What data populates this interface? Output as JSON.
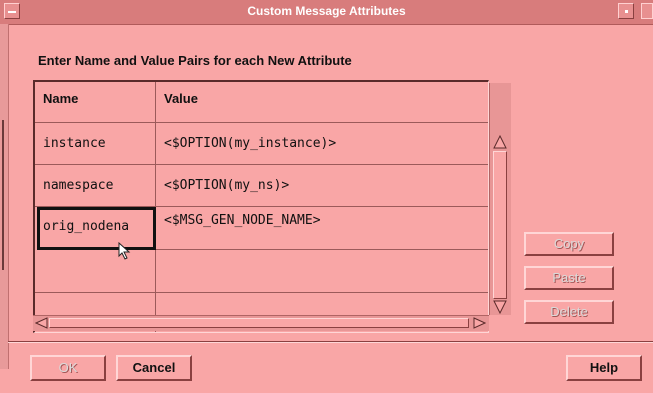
{
  "window": {
    "title": "Custom Message Attributes"
  },
  "instruction": "Enter Name and Value Pairs for each New Attribute",
  "table": {
    "headers": {
      "name": "Name",
      "value": "Value"
    },
    "rows": [
      {
        "name": "instance",
        "value": "<$OPTION(my_instance)>"
      },
      {
        "name": "namespace",
        "value": "<$OPTION(my_ns)>"
      },
      {
        "name": "orig_nodena",
        "value": "<$MSG_GEN_NODE_NAME>"
      },
      {
        "name": "",
        "value": ""
      },
      {
        "name": "",
        "value": ""
      }
    ],
    "selected_row": 2
  },
  "side_buttons": {
    "copy": "Copy",
    "paste": "Paste",
    "delete": "Delete"
  },
  "footer": {
    "ok": "OK",
    "cancel": "Cancel",
    "help": "Help"
  },
  "colors": {
    "background": "#f9a6a6",
    "title_bar": "#d87c7c",
    "title_text": "#ffffff"
  }
}
